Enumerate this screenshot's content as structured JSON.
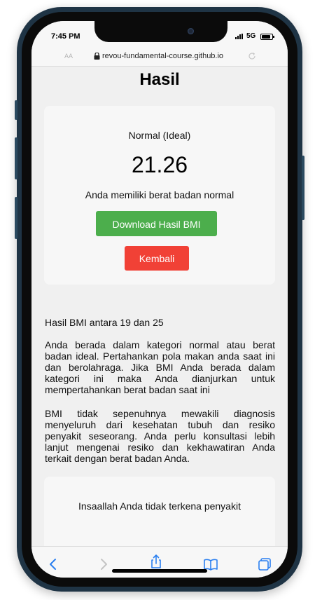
{
  "status": {
    "time": "7:45 PM",
    "network": "5G"
  },
  "browser": {
    "reader_label": "AA",
    "url": "revou-fundamental-course.github.io"
  },
  "page": {
    "title": "Hasil",
    "result": {
      "category": "Normal (Ideal)",
      "bmi": "21.26",
      "message": "Anda memiliki berat badan normal",
      "download_label": "Download Hasil BMI",
      "back_label": "Kembali"
    },
    "range_text": "Hasil BMI antara 19 dan 25",
    "paragraph1": "Anda berada dalam kategori normal atau berat badan ideal. Pertahankan pola makan anda saat ini dan berolahraga. Jika BMI Anda berada dalam kategori ini maka Anda dianjurkan untuk mempertahankan berat badan saat ini",
    "paragraph2": "BMI tidak sepenuhnya mewakili diagnosis menyeluruh dari kesehatan tubuh dan resiko penyakit seseorang. Anda perlu konsultasi lebih lanjut mengenai resiko dan kekhawatiran Anda terkait dengan berat badan Anda.",
    "disease_message": "Insaallah Anda tidak terkena penyakit"
  },
  "toolbar": {
    "icons": [
      "back-icon",
      "forward-icon",
      "share-icon",
      "bookmarks-icon",
      "tabs-icon"
    ]
  },
  "colors": {
    "download_button": "#4cae4c",
    "back_button": "#f14136",
    "toolbar_accent": "#2a7ff0",
    "frame": "#1f3445"
  }
}
